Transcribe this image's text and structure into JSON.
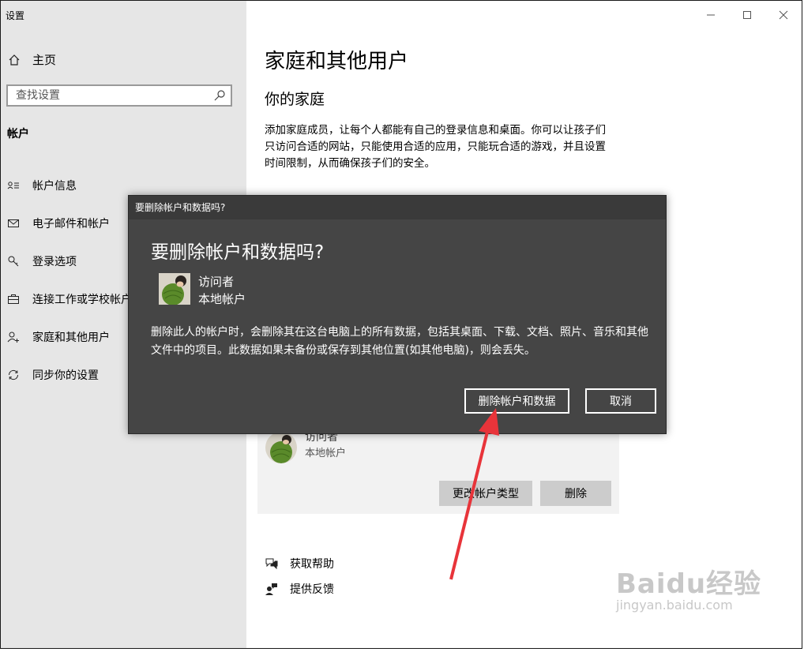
{
  "window": {
    "app_title": "设置",
    "controls": [
      "minimize-icon",
      "maximize-icon",
      "close-icon"
    ]
  },
  "sidebar": {
    "home_label": "主页",
    "search_placeholder": "查找设置",
    "section_heading": "帐户",
    "items": [
      {
        "label": "帐户信息",
        "icon": "account-info-icon"
      },
      {
        "label": "电子邮件和帐户",
        "icon": "email-icon"
      },
      {
        "label": "登录选项",
        "icon": "key-icon"
      },
      {
        "label": "连接工作或学校帐户",
        "icon": "briefcase-icon"
      },
      {
        "label": "家庭和其他用户",
        "icon": "add-person-icon"
      },
      {
        "label": "同步你的设置",
        "icon": "sync-icon"
      }
    ]
  },
  "main": {
    "title": "家庭和其他用户",
    "subtitle": "你的家庭",
    "description": "添加家庭成员，让每个人都能有自己的登录信息和桌面。你可以让孩子们只访问合适的网站，只能使用合适的应用，只能玩合适的游戏，并且设置时间限制，从而确保孩子们的安全。",
    "user": {
      "name": "访问者",
      "type": "本地帐户"
    },
    "change_type_button": "更改帐户类型",
    "delete_button": "删除",
    "links": [
      {
        "label": "获取帮助",
        "icon": "help-chat-icon"
      },
      {
        "label": "提供反馈",
        "icon": "feedback-icon"
      }
    ]
  },
  "dialog": {
    "window_title": "要删除帐户和数据吗?",
    "heading": "要删除帐户和数据吗?",
    "user_name": "访问者",
    "user_type": "本地帐户",
    "message": "删除此人的帐户时，会删除其在这台电脑上的所有数据，包括其桌面、下载、文档、照片、音乐和其他文件中的项目。此数据如果未备份或保存到其他位置(如其他电脑)，则会丢失。",
    "confirm_button": "删除帐户和数据",
    "cancel_button": "取消"
  },
  "watermark": {
    "logo": "Baidu经验",
    "url": "jingyan.baidu.com"
  },
  "colors": {
    "sidebar_bg": "#e6e6e6",
    "dialog_bg": "#454545",
    "annotation_arrow": "#e8343a"
  }
}
